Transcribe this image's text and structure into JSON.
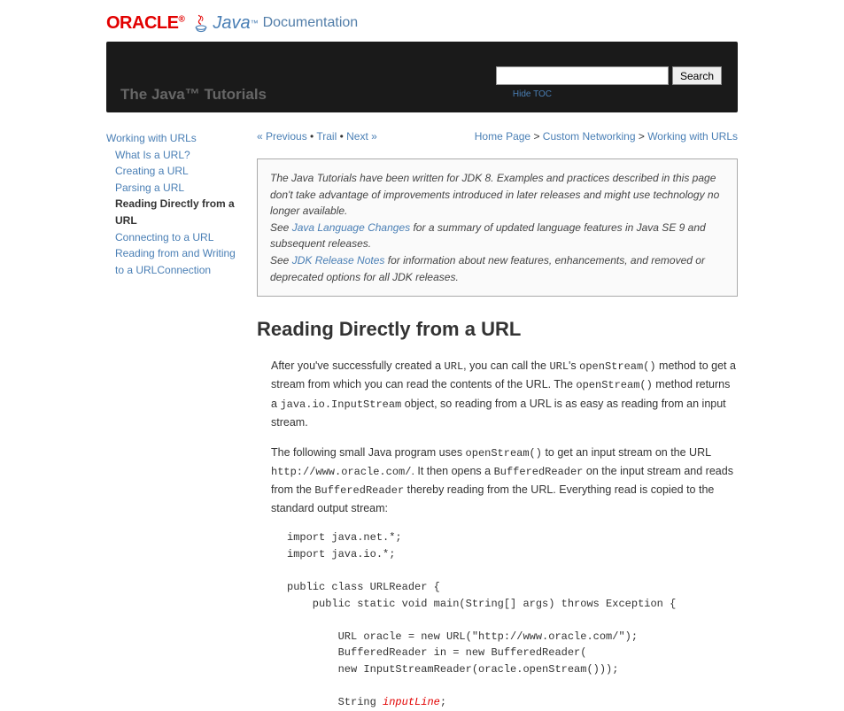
{
  "header": {
    "oracle": "ORACLE",
    "java": "Java",
    "trademark": "™",
    "doc": "Documentation"
  },
  "blackbar": {
    "title": "The Java™ Tutorials",
    "search_button": "Search",
    "hide_toc": "Hide TOC"
  },
  "sidebar": {
    "root": "Working with URLs",
    "items": [
      "What Is a URL?",
      "Creating a URL",
      "Parsing a URL"
    ],
    "current": "Reading Directly from a URL",
    "after": [
      "Connecting to a URL",
      "Reading from and Writing to a URLConnection"
    ]
  },
  "nav": {
    "prev": "« Previous",
    "sep": " • ",
    "trail": "Trail",
    "next": "Next »"
  },
  "breadcrumb": {
    "home": "Home Page",
    "sep": " > ",
    "section": "Custom Networking",
    "page": "Working with URLs"
  },
  "notice": {
    "p1": "The Java Tutorials have been written for JDK 8. Examples and practices described in this page don't take advantage of improvements introduced in later releases and might use technology no longer available.",
    "p2a": "See ",
    "p2link": "Java Language Changes",
    "p2b": " for a summary of updated language features in Java SE 9 and subsequent releases.",
    "p3a": "See ",
    "p3link": "JDK Release Notes",
    "p3b": " for information about new features, enhancements, and removed or deprecated options for all JDK releases."
  },
  "page": {
    "title": "Reading Directly from a URL"
  },
  "body": {
    "p1a": "After you've successfully created a ",
    "p1c1": "URL",
    "p1b": ", you can call the ",
    "p1c2": "URL",
    "p1c": "'s ",
    "p1c3": "openStream()",
    "p1d": " method to get a stream from which you can read the contents of the URL. The ",
    "p1c4": "openStream()",
    "p1e": " method returns a ",
    "p1link": "java.io.InputStream",
    "p1f": " object, so reading from a URL is as easy as reading from an input stream.",
    "p2a": "The following small Java program uses ",
    "p2c1": "openStream()",
    "p2b": " to get an input stream on the URL ",
    "p2c2": "http://www.oracle.com/",
    "p2c": ". It then opens a ",
    "p2c3": "BufferedReader",
    "p2d": " on the input stream and reads from the ",
    "p2c4": "BufferedReader",
    "p2e": " thereby reading from the URL. Everything read is copied to the standard output stream:"
  },
  "code": {
    "l1": "import java.net.*;",
    "l2": "import java.io.*;",
    "l3": "",
    "l4": "public class URLReader {",
    "l5": "    public static void main(String[] args) throws Exception {",
    "l6": "",
    "l7": "        URL oracle = new URL(\"http://www.oracle.com/\");",
    "l8": "        BufferedReader in = new BufferedReader(",
    "l9": "        new InputStreamReader(oracle.openStream()));",
    "l10": "",
    "l11a": "        String ",
    "l11b": "inputLine",
    "l11c": ";"
  }
}
